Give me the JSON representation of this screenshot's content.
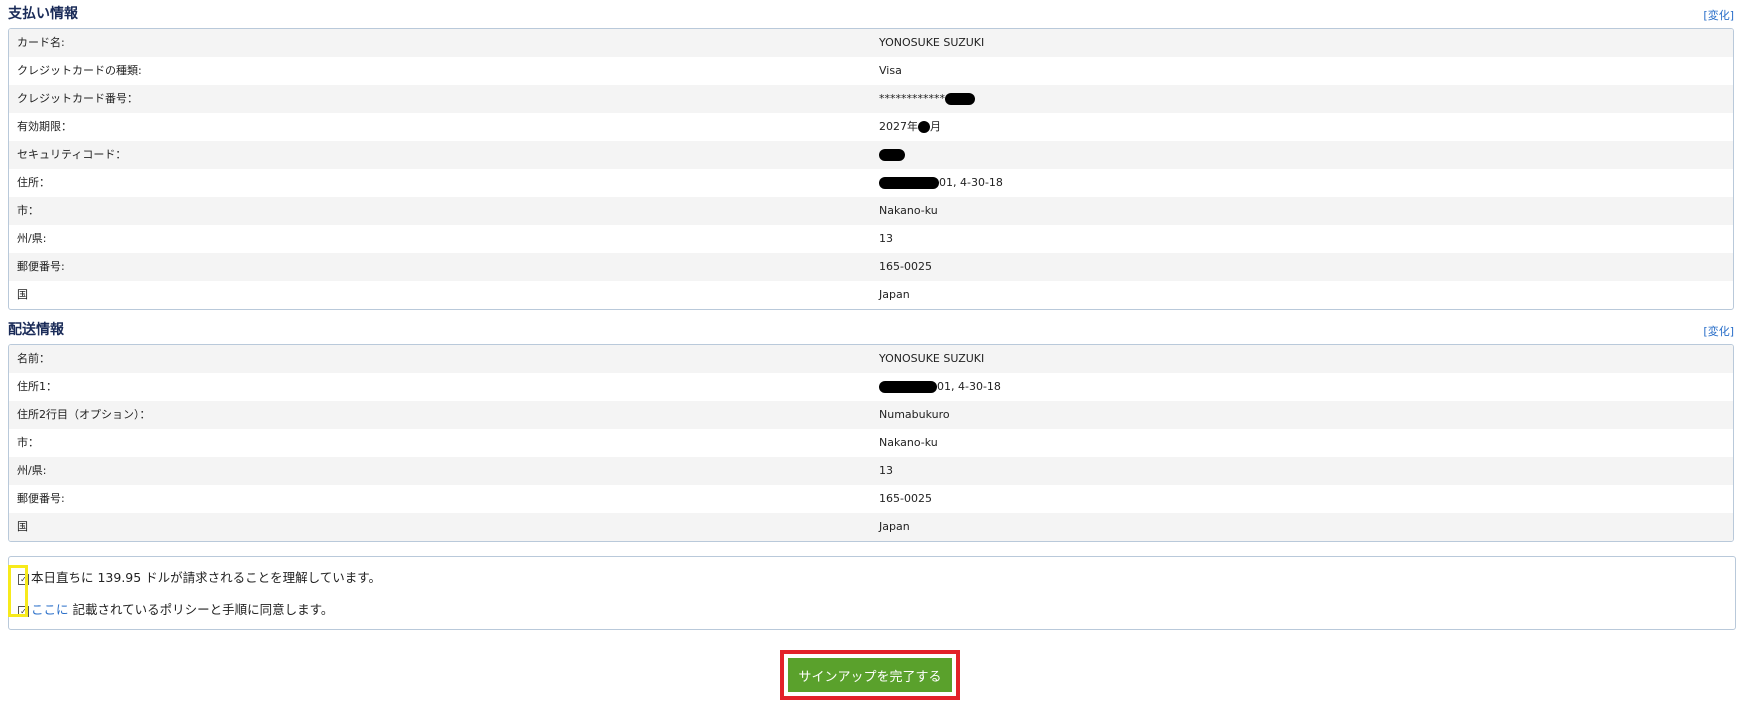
{
  "payment": {
    "title": "支払い情報",
    "change": "[変化]",
    "rows": [
      {
        "label": "カード名:",
        "value": "YONOSUKE SUZUKI"
      },
      {
        "label": "クレジットカードの種類:",
        "value": "Visa"
      },
      {
        "label": "クレジットカード番号：",
        "value": "************"
      },
      {
        "label": "有効期限：",
        "value_prefix": "2027年",
        "value_suffix": "月"
      },
      {
        "label": "セキュリティコード：",
        "value": ""
      },
      {
        "label": "住所：",
        "value": "01, 4-30-18"
      },
      {
        "label": "市：",
        "value": "Nakano-ku"
      },
      {
        "label": "州/県:",
        "value": "13"
      },
      {
        "label": "郵便番号:",
        "value": "165-0025"
      },
      {
        "label": "国",
        "value": "Japan"
      }
    ]
  },
  "shipping": {
    "title": "配送情報",
    "change": "[変化]",
    "rows": [
      {
        "label": "名前：",
        "value": "YONOSUKE SUZUKI"
      },
      {
        "label": "住所1：",
        "value": "01, 4-30-18"
      },
      {
        "label": "住所2行目（オプション）：",
        "value": "Numabukuro"
      },
      {
        "label": "市：",
        "value": "Nakano-ku"
      },
      {
        "label": "州/県:",
        "value": "13"
      },
      {
        "label": "郵便番号:",
        "value": "165-0025"
      },
      {
        "label": "国",
        "value": "Japan"
      }
    ]
  },
  "agreement": {
    "charge_text": "本日直ちに 139.95 ドルが請求されることを理解しています。",
    "policy_link": "ここに",
    "policy_text": " 記載されているポリシーと手順に同意します。",
    "charge_checked": true,
    "policy_checked": true
  },
  "submit": {
    "label": "サインアップを完了する"
  },
  "colors": {
    "accent_green": "#5aa12c",
    "highlight_red": "#e3222b",
    "highlight_yellow": "#f7ea1b",
    "link_blue": "#2a6fc9"
  }
}
